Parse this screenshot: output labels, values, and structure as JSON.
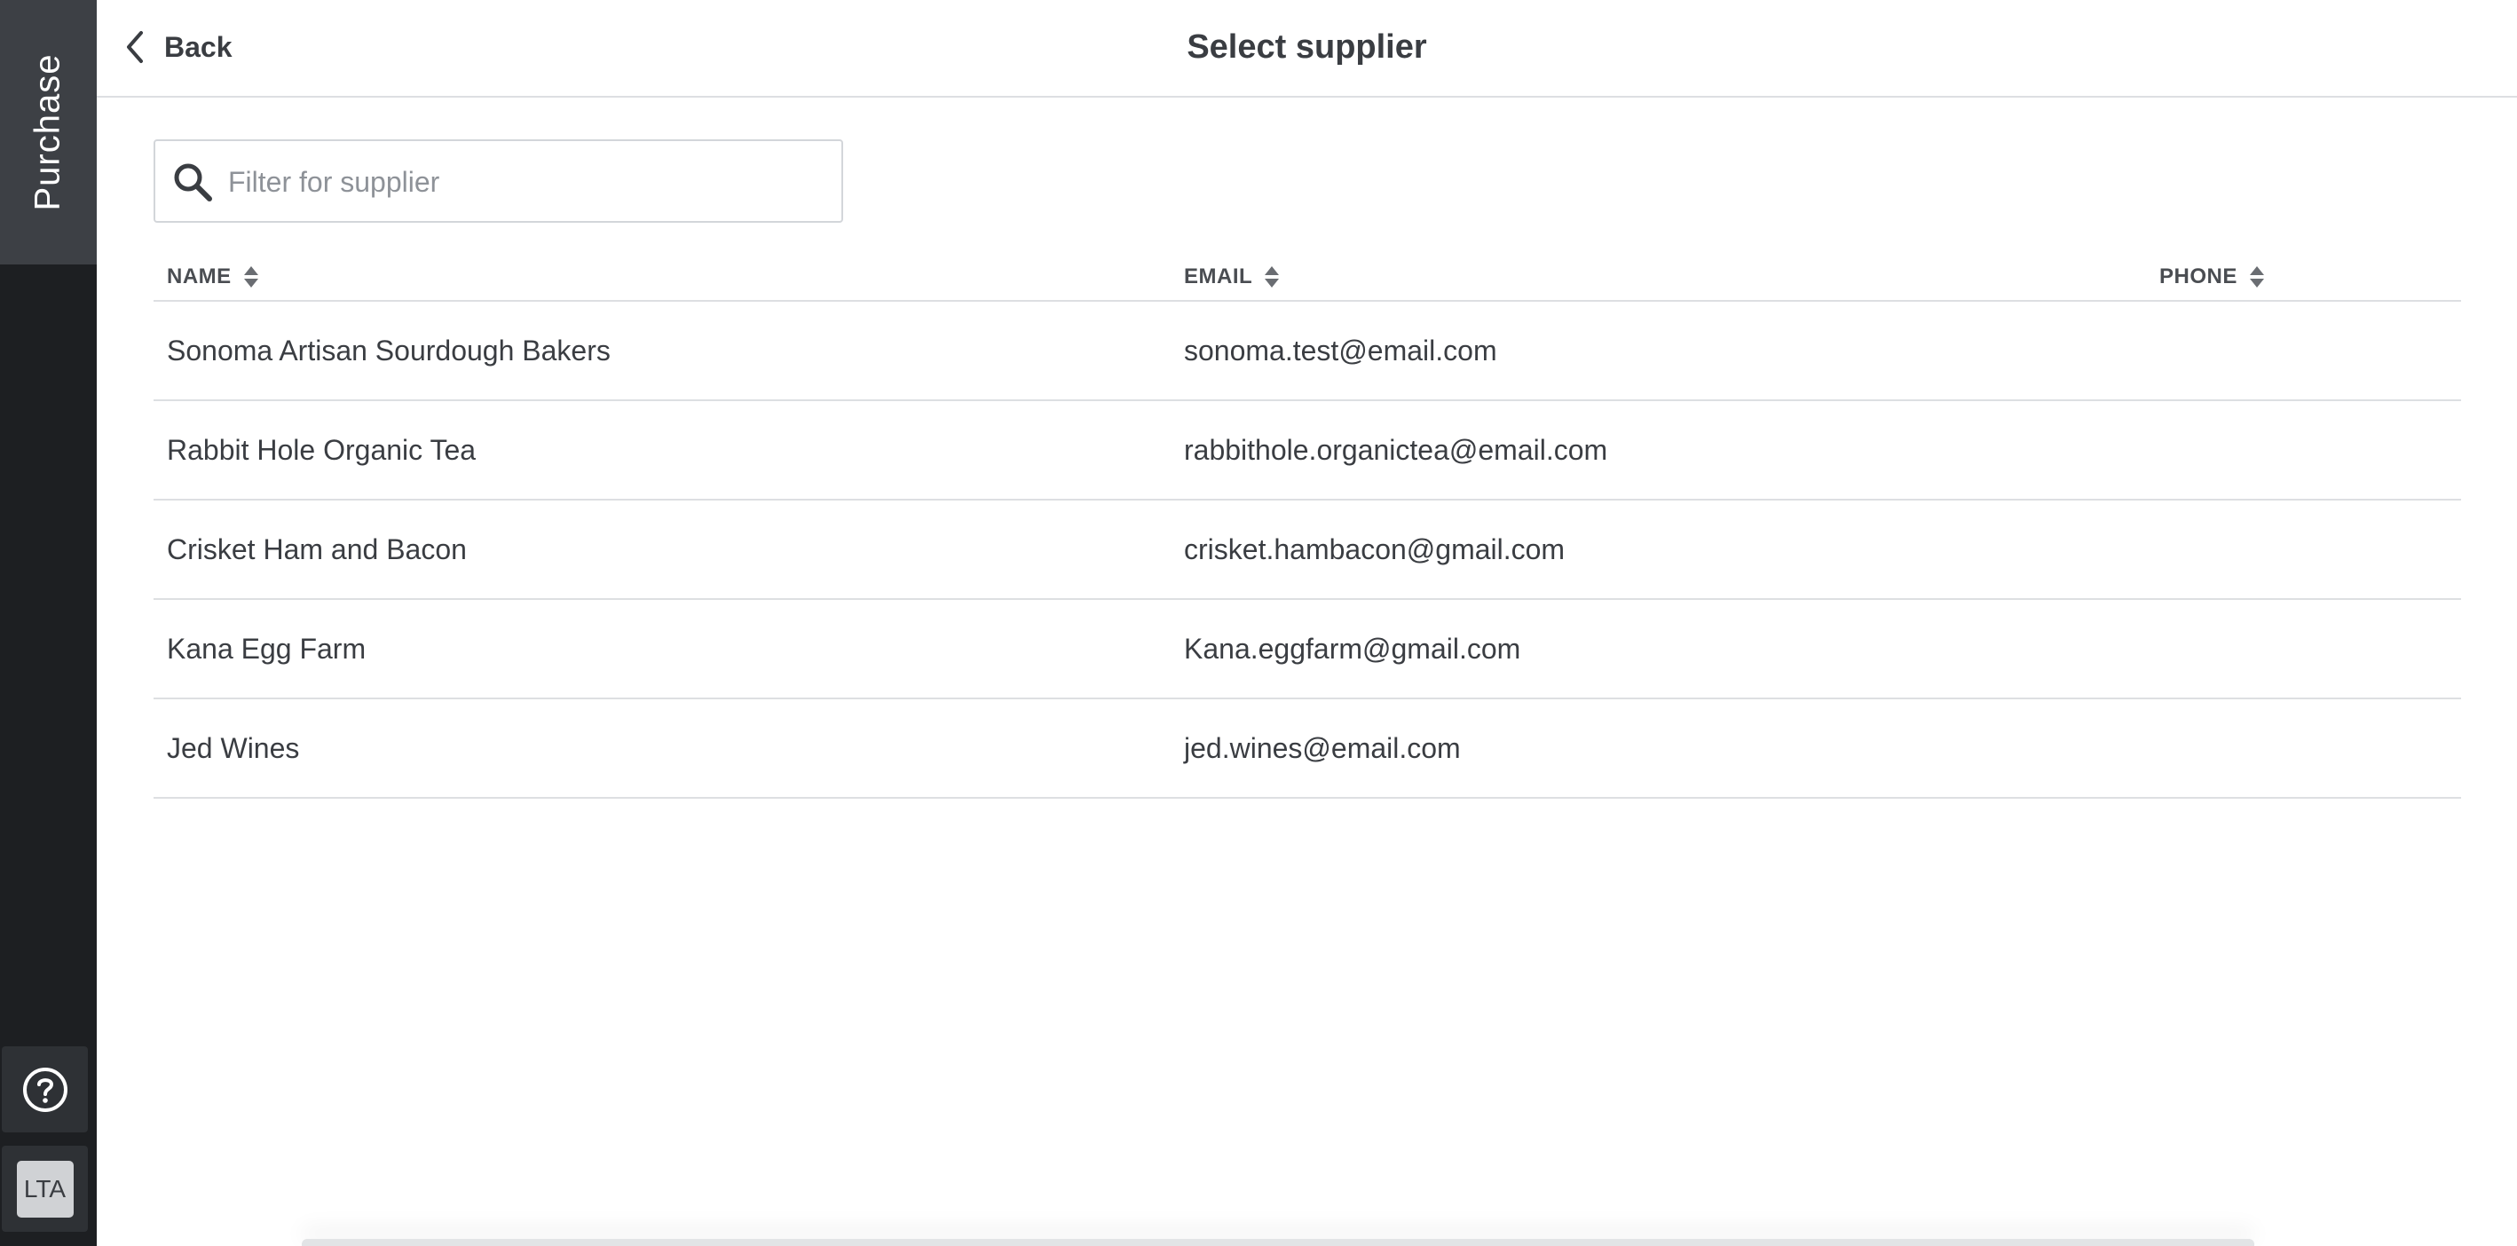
{
  "sidebar": {
    "active_tab": "Purchase",
    "help_icon": "help-circle-icon",
    "user_initials": "LTA"
  },
  "header": {
    "back_label": "Back",
    "title": "Select supplier"
  },
  "search": {
    "placeholder": "Filter for supplier",
    "value": ""
  },
  "table": {
    "columns": [
      "NAME",
      "EMAIL",
      "PHONE"
    ],
    "rows": [
      {
        "name": "Sonoma Artisan Sourdough Bakers",
        "email": "sonoma.test@email.com",
        "phone": ""
      },
      {
        "name": "Rabbit Hole Organic Tea",
        "email": "rabbithole.organictea@email.com",
        "phone": ""
      },
      {
        "name": "Crisket Ham and Bacon",
        "email": "crisket.hambacon@gmail.com",
        "phone": ""
      },
      {
        "name": "Kana Egg Farm",
        "email": "Kana.eggfarm@gmail.com",
        "phone": ""
      },
      {
        "name": "Jed Wines",
        "email": "jed.wines@email.com",
        "phone": ""
      }
    ]
  },
  "colors": {
    "sidebar_bg": "#1d1f22",
    "sidebar_active_bg": "#3d4045",
    "text": "#3a3d42",
    "divider": "#dddfe2"
  }
}
